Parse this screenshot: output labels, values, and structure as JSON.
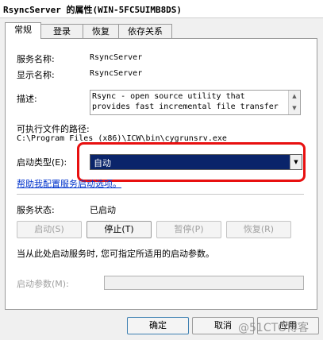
{
  "window": {
    "title": "RsyncServer 的属性(WIN-5FC5UIMB8DS)"
  },
  "tabs": [
    {
      "label": "常规"
    },
    {
      "label": "登录"
    },
    {
      "label": "恢复"
    },
    {
      "label": "依存关系"
    }
  ],
  "general": {
    "service_name_label": "服务名称:",
    "service_name": "RsyncServer",
    "display_name_label": "显示名称:",
    "display_name": "RsyncServer",
    "description_label": "描述:",
    "description": "Rsync - open source utility that provides fast incremental file transfer",
    "exe_path_label": "可执行文件的路径:",
    "exe_path": "C:\\Program Files (x86)\\ICW\\bin\\cygrunsrv.exe",
    "startup_type_label": "启动类型(E):",
    "startup_type": "自动",
    "help_link": "帮助我配置服务启动选项。",
    "status_label": "服务状态:",
    "status": "已启动",
    "buttons": {
      "start": "启动(S)",
      "stop": "停止(T)",
      "pause": "暂停(P)",
      "resume": "恢复(R)"
    },
    "hint": "当从此处启动服务时, 您可指定所适用的启动参数。",
    "params_label": "启动参数(M):",
    "params_value": ""
  },
  "footer": {
    "ok": "确定",
    "cancel": "取消",
    "apply": "应用"
  },
  "watermark": "@51CTO博客",
  "colors": {
    "selection": "#0a246a",
    "highlight_box": "#e81010",
    "link": "#0033cc"
  }
}
